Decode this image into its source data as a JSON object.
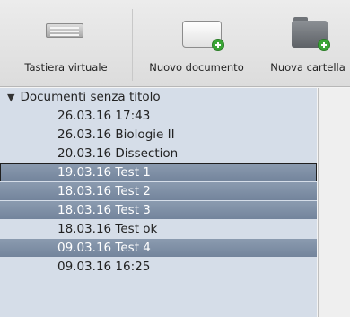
{
  "toolbar": {
    "keyboard_label": "Tastiera virtuale",
    "new_document_label": "Nuovo documento",
    "new_folder_label": "Nuova cartella"
  },
  "sidebar": {
    "group_label": "Documenti senza titolo",
    "items": [
      {
        "label": "26.03.16 17:43",
        "selected": false
      },
      {
        "label": "26.03.16 Biologie II",
        "selected": false
      },
      {
        "label": "20.03.16 Dissection",
        "selected": false
      },
      {
        "label": "19.03.16 Test 1",
        "selected": true
      },
      {
        "label": "18.03.16 Test 2",
        "selected": true
      },
      {
        "label": "18.03.16 Test 3",
        "selected": true
      },
      {
        "label": "18.03.16 Test ok",
        "selected": false
      },
      {
        "label": "09.03.16 Test 4",
        "selected": true
      },
      {
        "label": "09.03.16 16:25",
        "selected": false
      }
    ]
  },
  "colors": {
    "sidebar_bg": "#d5dde8",
    "selection": "#7d8ea6",
    "add_badge": "#3aa536"
  }
}
